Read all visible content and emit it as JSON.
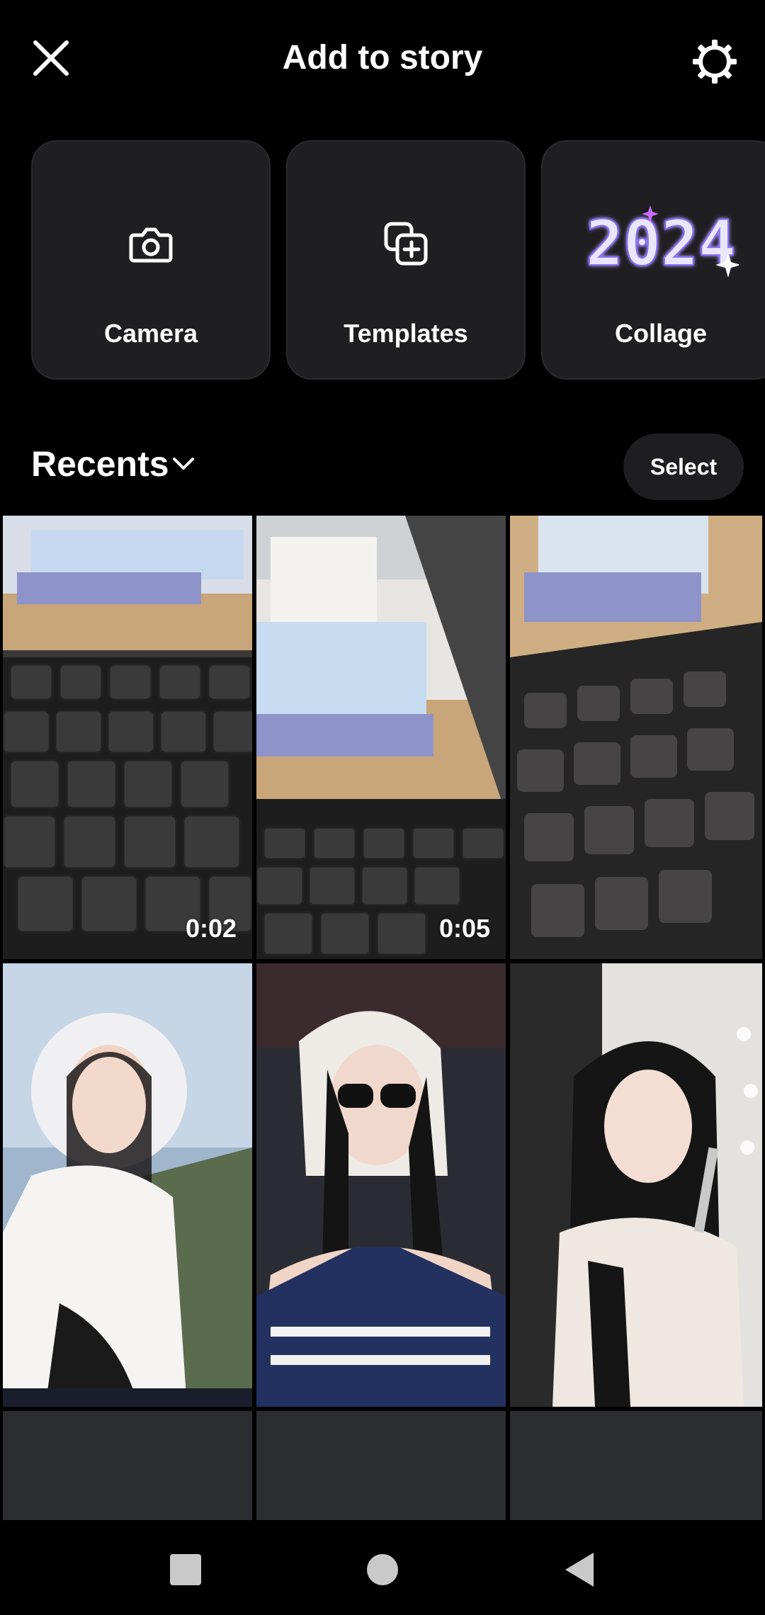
{
  "header": {
    "title": "Add to story",
    "close_icon": "close-icon",
    "settings_icon": "gear-icon"
  },
  "shortcuts": [
    {
      "label": "Camera",
      "icon": "camera-icon"
    },
    {
      "label": "Templates",
      "icon": "templates-icon"
    },
    {
      "label": "Collage",
      "icon": "collage-2024-art",
      "art_text": "2024"
    }
  ],
  "recents": {
    "label": "Recents",
    "select_label": "Select"
  },
  "media": [
    {
      "type": "video",
      "duration": "0:02"
    },
    {
      "type": "video",
      "duration": "0:05"
    },
    {
      "type": "photo"
    },
    {
      "type": "photo"
    },
    {
      "type": "photo"
    },
    {
      "type": "photo"
    },
    {
      "type": "photo"
    },
    {
      "type": "photo"
    },
    {
      "type": "photo"
    }
  ],
  "colors": {
    "background": "#000000",
    "card": "#1f1f22",
    "placeholder": "#2b2d31",
    "accent_purple": "#b47cff"
  }
}
